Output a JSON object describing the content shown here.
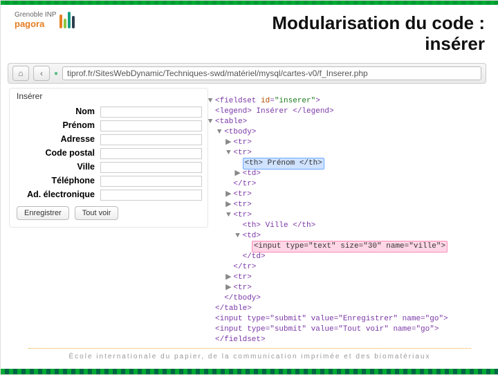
{
  "brand": {
    "line1": "Grenoble INP",
    "line2": "pagora"
  },
  "title": {
    "l1": "Modularisation du code :",
    "l2": "insérer"
  },
  "addressbar": {
    "home_icon": "⌂",
    "back_icon": "‹",
    "site_icon": "●",
    "url": "tiprof.fr/SitesWebDynamic/Techniques-swd/matériel/mysql/cartes-v0/f_Inserer.php"
  },
  "form": {
    "legend": "Insérer",
    "fields": [
      {
        "label": "Nom",
        "value": ""
      },
      {
        "label": "Prénom",
        "value": ""
      },
      {
        "label": "Adresse",
        "value": ""
      },
      {
        "label": "Code postal",
        "value": ""
      },
      {
        "label": "Ville",
        "value": ""
      },
      {
        "label": "Téléphone",
        "value": ""
      },
      {
        "label": "Ad. électronique",
        "value": ""
      }
    ],
    "buttons": {
      "submit": "Enregistrer",
      "viewall": "Tout voir"
    }
  },
  "code": {
    "l0": {
      "tri": "▼",
      "text": "<fieldset id=\"inserer\">",
      "id_attr": "id",
      "id_val": "\"inserer\""
    },
    "l1": {
      "text": "<legend> Insérer </legend>"
    },
    "l2": {
      "tri": "▼",
      "text": "<table>"
    },
    "l3": {
      "tri": "▼",
      "indent": "  ",
      "text": "<tbody>"
    },
    "l4": {
      "tri": "▶",
      "indent": "    ",
      "text": "<tr>"
    },
    "l5": {
      "tri": "▼",
      "indent": "    ",
      "text": "<tr>"
    },
    "l6": {
      "indent": "      ",
      "hl": "blue",
      "text": "<th> Prénom </th>"
    },
    "l7": {
      "tri": "▶",
      "indent": "      ",
      "text": "<td>"
    },
    "l8": {
      "indent": "    ",
      "text": "</tr>"
    },
    "l9": {
      "tri": "▶",
      "indent": "    ",
      "text": "<tr>"
    },
    "l10": {
      "tri": "▶",
      "indent": "    ",
      "text": "<tr>"
    },
    "l11": {
      "tri": "▼",
      "indent": "    ",
      "text": "<tr>"
    },
    "l12": {
      "indent": "      ",
      "text": "<th> Ville </th>"
    },
    "l13": {
      "tri": "▼",
      "indent": "      ",
      "text": "<td>"
    },
    "l14": {
      "indent": "        ",
      "hl": "pink",
      "text": "<input type=\"text\" size=\"30\" name=\"ville\">"
    },
    "l15": {
      "indent": "      ",
      "text": "</td>"
    },
    "l16": {
      "indent": "    ",
      "text": "</tr>"
    },
    "l17": {
      "tri": "▶",
      "indent": "    ",
      "text": "<tr>"
    },
    "l18": {
      "tri": "▶",
      "indent": "    ",
      "text": "<tr>"
    },
    "l19": {
      "indent": "  ",
      "text": "</tbody>"
    },
    "l20": {
      "text": "</table>"
    },
    "l21": {
      "text": "<input type=\"submit\" value=\"Enregistrer\" name=\"go\">"
    },
    "l22": {
      "text": "<input type=\"submit\" value=\"Tout voir\" name=\"go\">"
    },
    "l23": {
      "text": "</fieldset>"
    }
  },
  "footer": "École internationale du papier, de la communication imprimée et des biomatériaux"
}
